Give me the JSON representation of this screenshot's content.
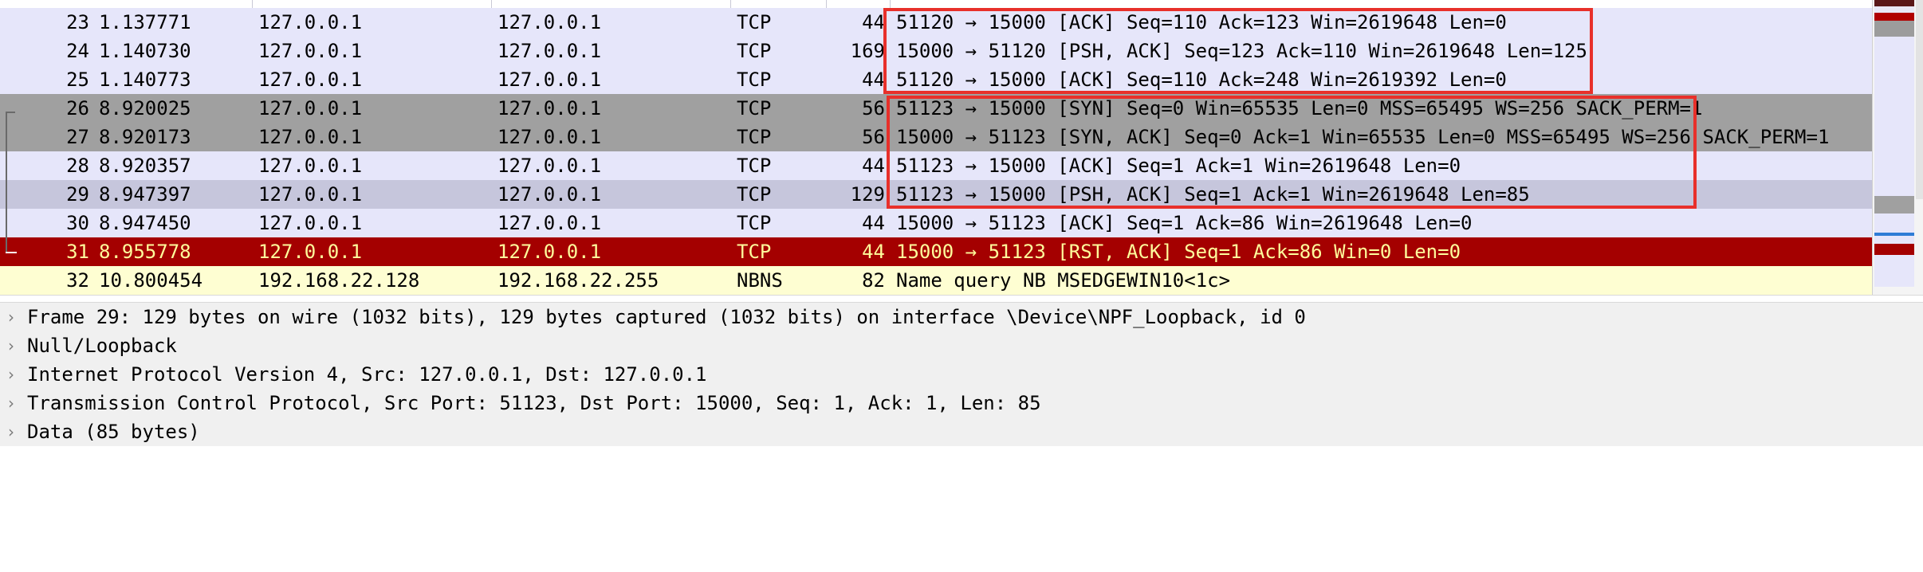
{
  "packet_list": {
    "rows": [
      {
        "no": "23",
        "time": "1.137771",
        "src": "127.0.0.1",
        "dst": "127.0.0.1",
        "proto": "TCP",
        "len": "44",
        "info": "51120 → 15000 [ACK] Seq=110 Ack=123 Win=2619648 Len=0",
        "bg": "#e6e6fa",
        "fg": "#000000"
      },
      {
        "no": "24",
        "time": "1.140730",
        "src": "127.0.0.1",
        "dst": "127.0.0.1",
        "proto": "TCP",
        "len": "169",
        "info": "15000 → 51120 [PSH, ACK] Seq=123 Ack=110 Win=2619648 Len=125",
        "bg": "#e6e6fa",
        "fg": "#000000"
      },
      {
        "no": "25",
        "time": "1.140773",
        "src": "127.0.0.1",
        "dst": "127.0.0.1",
        "proto": "TCP",
        "len": "44",
        "info": "51120 → 15000 [ACK] Seq=110 Ack=248 Win=2619392 Len=0",
        "bg": "#e6e6fa",
        "fg": "#000000"
      },
      {
        "no": "26",
        "time": "8.920025",
        "src": "127.0.0.1",
        "dst": "127.0.0.1",
        "proto": "TCP",
        "len": "56",
        "info": "51123 → 15000 [SYN] Seq=0 Win=65535 Len=0 MSS=65495 WS=256 SACK_PERM=1",
        "bg": "#a0a0a0",
        "fg": "#000000"
      },
      {
        "no": "27",
        "time": "8.920173",
        "src": "127.0.0.1",
        "dst": "127.0.0.1",
        "proto": "TCP",
        "len": "56",
        "info": "15000 → 51123 [SYN, ACK] Seq=0 Ack=1 Win=65535 Len=0 MSS=65495 WS=256 SACK_PERM=1",
        "bg": "#a0a0a0",
        "fg": "#000000"
      },
      {
        "no": "28",
        "time": "8.920357",
        "src": "127.0.0.1",
        "dst": "127.0.0.1",
        "proto": "TCP",
        "len": "44",
        "info": "51123 → 15000 [ACK] Seq=1 Ack=1 Win=2619648 Len=0",
        "bg": "#e6e6fa",
        "fg": "#000000"
      },
      {
        "no": "29",
        "time": "8.947397",
        "src": "127.0.0.1",
        "dst": "127.0.0.1",
        "proto": "TCP",
        "len": "129",
        "info": "51123 → 15000 [PSH, ACK] Seq=1 Ack=1 Win=2619648 Len=85",
        "bg": "#c6c6dc",
        "fg": "#000000"
      },
      {
        "no": "30",
        "time": "8.947450",
        "src": "127.0.0.1",
        "dst": "127.0.0.1",
        "proto": "TCP",
        "len": "44",
        "info": "15000 → 51123 [ACK] Seq=1 Ack=86 Win=2619648 Len=0",
        "bg": "#e6e6fa",
        "fg": "#000000"
      },
      {
        "no": "31",
        "time": "8.955778",
        "src": "127.0.0.1",
        "dst": "127.0.0.1",
        "proto": "TCP",
        "len": "44",
        "info": "15000 → 51123 [RST, ACK] Seq=1 Ack=86 Win=0 Len=0",
        "bg": "#a40000",
        "fg": "#fffc9c"
      },
      {
        "no": "32",
        "time": "10.800454",
        "src": "192.168.22.128",
        "dst": "192.168.22.255",
        "proto": "NBNS",
        "len": "82",
        "info": "Name query NB MSEDGEWIN10<1c>",
        "bg": "#fefed2",
        "fg": "#000000"
      }
    ]
  },
  "packet_details": {
    "expander_icon": "chevron-right-icon",
    "expander_glyph": "›",
    "rows": [
      {
        "text": "Frame 29: 129 bytes on wire (1032 bits), 129 bytes captured (1032 bits) on interface \\Device\\NPF_Loopback, id 0"
      },
      {
        "text": "Null/Loopback"
      },
      {
        "text": "Internet Protocol Version 4, Src: 127.0.0.1, Dst: 127.0.0.1"
      },
      {
        "text": "Transmission Control Protocol, Src Port: 51123, Dst Port: 15000, Seq: 1, Ack: 1, Len: 85"
      },
      {
        "text": "Data (85 bytes)"
      }
    ]
  },
  "colors": {
    "highlight_box": "#e8302a",
    "details_bg": "#f0f0f0"
  }
}
